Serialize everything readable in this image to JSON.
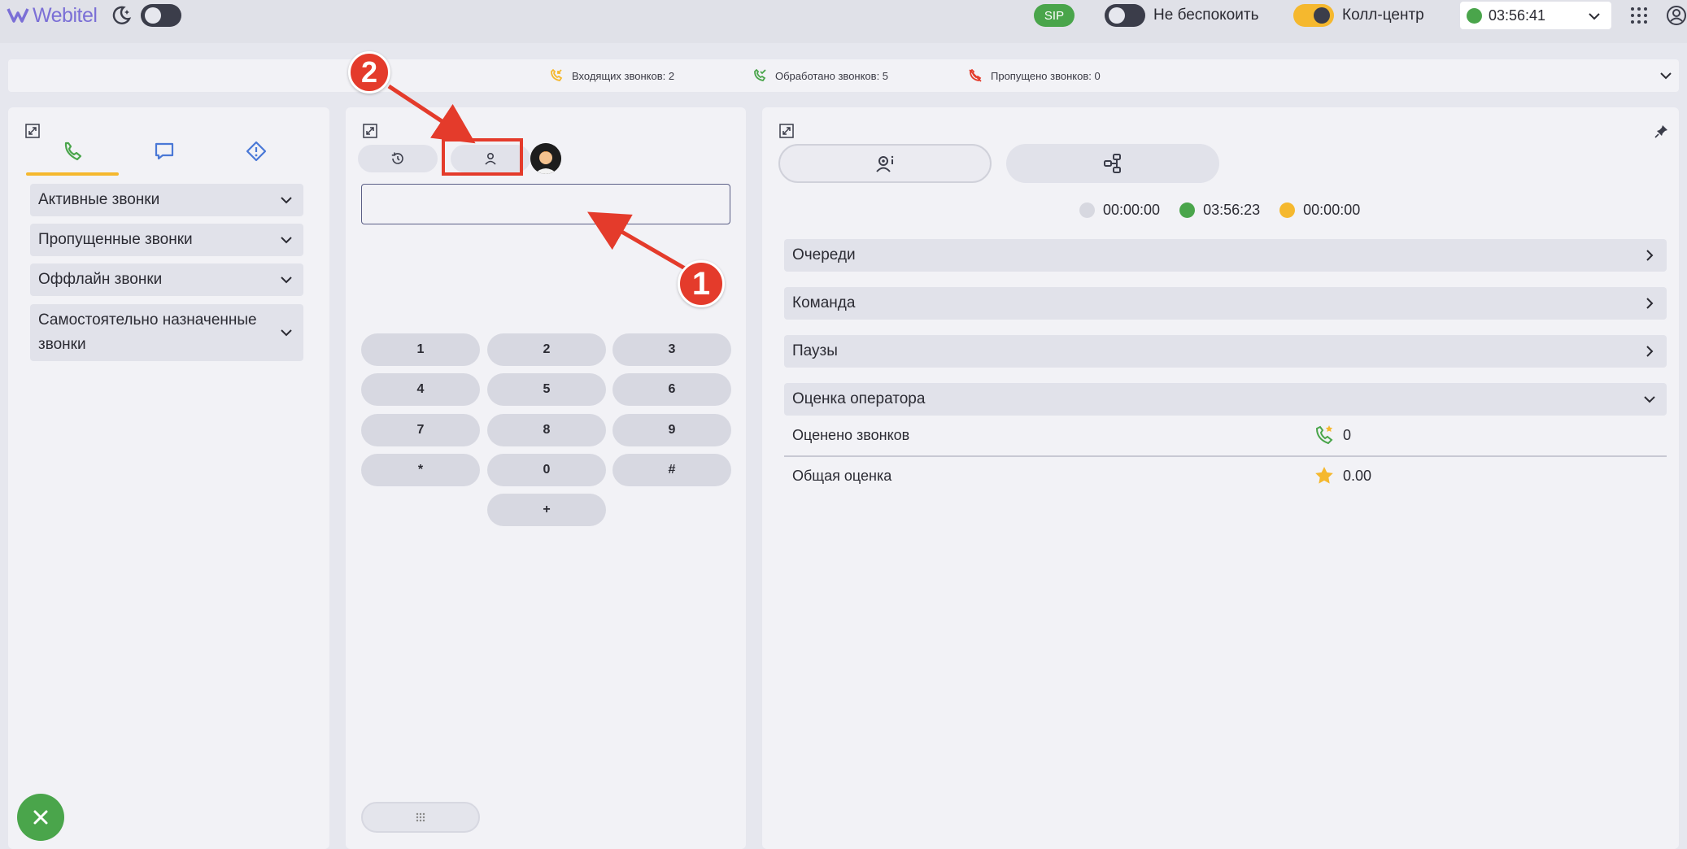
{
  "header": {
    "logo_text": "Webitel",
    "sip_label": "SIP",
    "dnd_label": "Не беспокоить",
    "callcenter_label": "Колл-центр",
    "status_time": "03:56:41",
    "dnd_toggle_on": false,
    "callcenter_toggle_on": true,
    "theme_toggle_on": false
  },
  "stats": {
    "incoming": "Входящих звонков: 2",
    "handled": "Обработано звонков: 5",
    "missed": "Пропущено звонков: 0"
  },
  "left_panel": {
    "accordions": [
      {
        "label": "Активные звонки"
      },
      {
        "label": "Пропущенные звонки"
      },
      {
        "label": "Оффлайн звонки"
      },
      {
        "label": "Самостоятельно назначенные звонки"
      }
    ]
  },
  "dialer": {
    "number_value": "",
    "keys": [
      "1",
      "2",
      "3",
      "4",
      "5",
      "6",
      "7",
      "8",
      "9",
      "*",
      "0",
      "#",
      "+"
    ]
  },
  "agent_panel": {
    "timers": [
      {
        "value": "00:00:00",
        "color": "#d7d8e0"
      },
      {
        "value": "03:56:23",
        "color": "#4aa54b"
      },
      {
        "value": "00:00:00",
        "color": "#f5b82e"
      }
    ],
    "sections": [
      {
        "label": "Очереди"
      },
      {
        "label": "Команда"
      },
      {
        "label": "Паузы"
      },
      {
        "label": "Оценка оператора"
      }
    ],
    "rating_rows": [
      {
        "label": "Оценено звонков",
        "value": "0"
      },
      {
        "label": "Общая оценка",
        "value": "0.00"
      }
    ]
  },
  "annotations": {
    "badge_1": "1",
    "badge_2": "2"
  },
  "colors": {
    "accent_yellow": "#f5b82e",
    "green": "#4aa54b",
    "red_annotation": "#e43b2b",
    "logo_purple": "#7b6fd6"
  }
}
